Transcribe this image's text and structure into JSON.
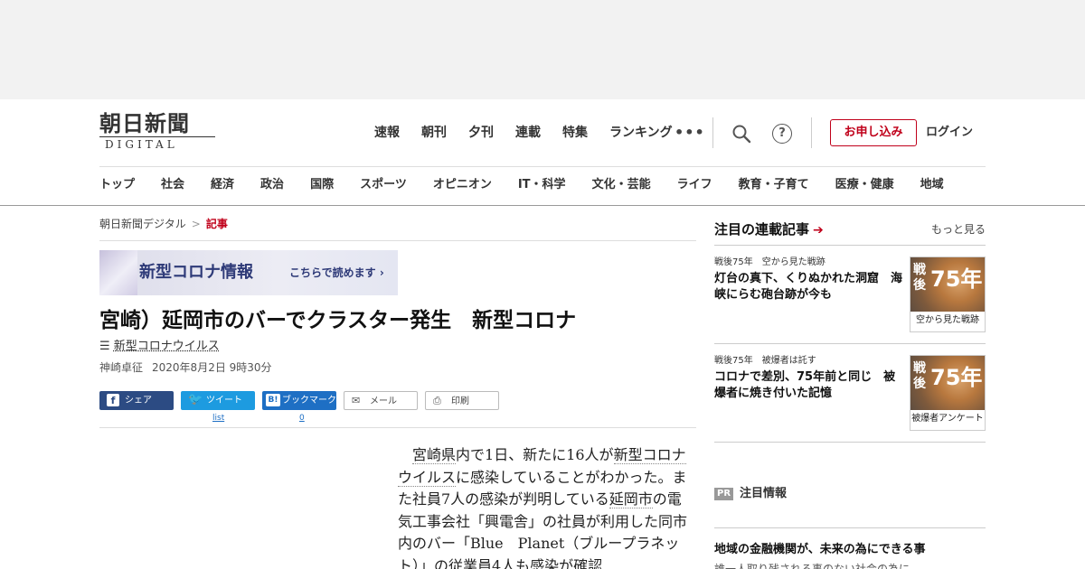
{
  "ad": {},
  "header": {
    "logo_main": "朝日新聞",
    "logo_sub": "DIGITAL",
    "top_nav": [
      "速報",
      "朝刊",
      "夕刊",
      "連載",
      "特集",
      "ランキング"
    ],
    "more": "•••",
    "help": "?",
    "subscribe_label": "お申し込み",
    "login_label": "ログイン",
    "categories": [
      "トップ",
      "社会",
      "経済",
      "政治",
      "国際",
      "スポーツ",
      "オピニオン",
      "IT・科学",
      "文化・芸能",
      "ライフ",
      "教育・子育て",
      "医療・健康",
      "地域"
    ]
  },
  "breadcrumb": {
    "home": "朝日新聞デジタル",
    "sep": ">",
    "current": "記事"
  },
  "banner": {
    "title": "新型コロナ情報",
    "link": "こちらで読めます ›"
  },
  "article": {
    "title": "宮崎）延岡市のバーでクラスター発生　新型コロナ",
    "tag_icon": "☰",
    "tag": "新型コロナウイルス",
    "author": "神崎卓征",
    "date": "2020年8月2日 9時30分",
    "share": {
      "facebook": "シェア",
      "twitter": "ツイート",
      "hatena": "ブックマーク",
      "mail": "メール",
      "print": "印刷",
      "twitter_count": "list",
      "hatena_count": "0"
    },
    "body": {
      "s1": "宮崎県",
      "s2": "内で1日、新たに16人が",
      "s3": "新型コロナウイルス",
      "s4": "に感染していることがわかった。また社員7人の感染が判明している",
      "s5": "延岡市",
      "s6": "の電気工事会社「興電舎」の社員が利用した同市内のバー「Blue　Planet（ブループラネット）」の従業員4人も感染が確認"
    }
  },
  "sidebar": {
    "heading": "注目の連載記事",
    "heading_arrow": "➔",
    "more": "もっと見る",
    "items": [
      {
        "category": "戦後75年　空から見た戦跡",
        "title": "灯台の真下、くりぬかれた洞窟　海峡にらむ砲台跡が今も",
        "thumb_kanji": "戦後",
        "thumb_num": "75年",
        "thumb_caption": "空から見た戦跡"
      },
      {
        "category": "戦後75年　被爆者は託す",
        "title": "コロナで差別、75年前と同じ　被爆者に焼き付いた記憶",
        "thumb_kanji": "戦後",
        "thumb_num": "75年",
        "thumb_caption": "被爆者アンケート"
      }
    ],
    "pr": {
      "label": "PR",
      "title": "注目情報",
      "item": "地域の金融機関が、未来の為にできる事",
      "sub": "誰一人取り残される事のない社会の為に"
    }
  }
}
